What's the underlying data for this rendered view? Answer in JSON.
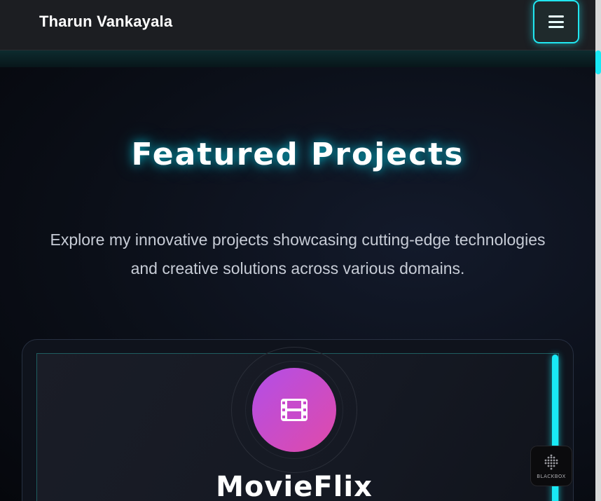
{
  "header": {
    "brand": "Tharun Vankayala",
    "menu_icon": "hamburger-icon"
  },
  "hero": {
    "title": "Featured Projects",
    "subtitle": "Explore my innovative projects showcasing cutting-edge technologies and creative solutions across various domains."
  },
  "project_card": {
    "title": "MovieFlix",
    "icon": "film-icon",
    "icon_gradient": [
      "#b24ee8",
      "#e04aa9"
    ],
    "accent_color": "#19e9f5"
  },
  "widget": {
    "label": "BLACKBOX",
    "icon": "blackbox-logo-icon"
  },
  "colors": {
    "accent": "#21e6f0",
    "background": "#0a0f17"
  }
}
